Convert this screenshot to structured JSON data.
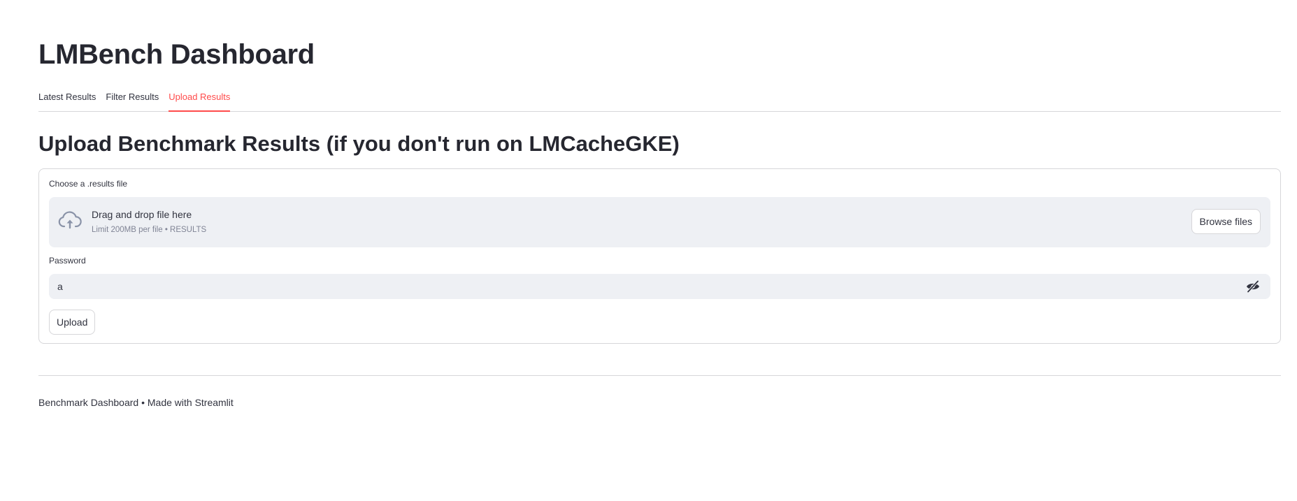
{
  "app": {
    "title": "LMBench Dashboard"
  },
  "tabs": [
    {
      "label": "Latest Results",
      "active": false
    },
    {
      "label": "Filter Results",
      "active": false
    },
    {
      "label": "Upload Results",
      "active": true
    }
  ],
  "upload_section": {
    "title": "Upload Benchmark Results (if you don't run on LMCacheGKE)",
    "file_uploader": {
      "label": "Choose a .results file",
      "drop_text": "Drag and drop file here",
      "limit_text": "Limit 200MB per file • RESULTS",
      "browse_label": "Browse files",
      "icon": "cloud-upload-icon"
    },
    "password": {
      "label": "Password",
      "value": "a",
      "toggle_icon": "eye-slash-icon"
    },
    "upload_label": "Upload"
  },
  "footer": {
    "text": "Benchmark Dashboard • Made with Streamlit"
  },
  "colors": {
    "accent": "#ff4b4b",
    "text": "#31333f",
    "heading": "#262730",
    "input_bg": "#eef0f4",
    "border": "#d6d6d9",
    "muted": "#808495"
  }
}
